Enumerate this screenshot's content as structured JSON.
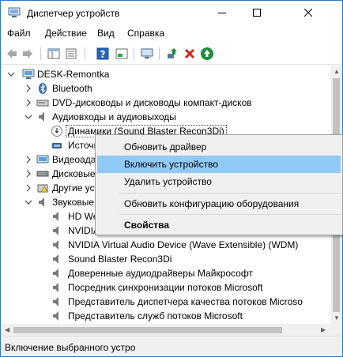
{
  "window": {
    "title": "Диспетчер устройств"
  },
  "menu": [
    "Файл",
    "Действие",
    "Вид",
    "Справка"
  ],
  "tree": {
    "root": "DESK-Remontka",
    "nodes": [
      {
        "label": "Bluetooth",
        "icon": "bluetooth-icon"
      },
      {
        "label": "DVD-дисководы и дисководы компакт-дисков",
        "icon": "dvd-drive-icon"
      },
      {
        "label": "Аудиовходы и аудиовыходы",
        "icon": "speaker-icon"
      },
      {
        "label": "Динамики (Sound Blaster Recon3Di)",
        "icon": "disabled-speaker-icon"
      },
      {
        "label": "Источники",
        "icon": "audio-input-icon"
      },
      {
        "label": "Видеоадаптеры",
        "icon": "display-adapter-icon"
      },
      {
        "label": "Дисковые",
        "icon": "disk-drive-icon"
      },
      {
        "label": "Другие устр",
        "icon": "unknown-device-icon"
      },
      {
        "label": "Звуковые, ви",
        "icon": "sound-device-icon"
      },
      {
        "label": "HD We",
        "icon": "sound-device-icon"
      },
      {
        "label": "NVIDIA",
        "icon": "sound-device-icon"
      },
      {
        "label": "NVIDIA Virtual Audio Device (Wave Extensible) (WDM)",
        "icon": "sound-device-icon"
      },
      {
        "label": "Sound Blaster Recon3Di",
        "icon": "sound-device-icon"
      },
      {
        "label": "Доверенные аудиодрайверы Майкрософт",
        "icon": "sound-device-icon"
      },
      {
        "label": "Посредник синхронизации потоков Microsoft",
        "icon": "sound-device-icon"
      },
      {
        "label": "Представитель диспетчера качества потоков Microso",
        "icon": "sound-device-icon"
      },
      {
        "label": "Представитель служб потоков Microsoft",
        "icon": "sound-device-icon"
      }
    ]
  },
  "context_menu": {
    "items": [
      "Обновить драйвер",
      "Включить устройство",
      "Удалить устройство",
      "Обновить конфигурацию оборудования",
      "Свойства"
    ],
    "highlighted_index": 1
  },
  "status": {
    "text": "Включение выбранного устро"
  },
  "colors": {
    "highlight": "#91c9f7",
    "border": "#2b78c5",
    "toolbar_red": "#c42b1c",
    "toolbar_green": "#1e8e3e"
  }
}
